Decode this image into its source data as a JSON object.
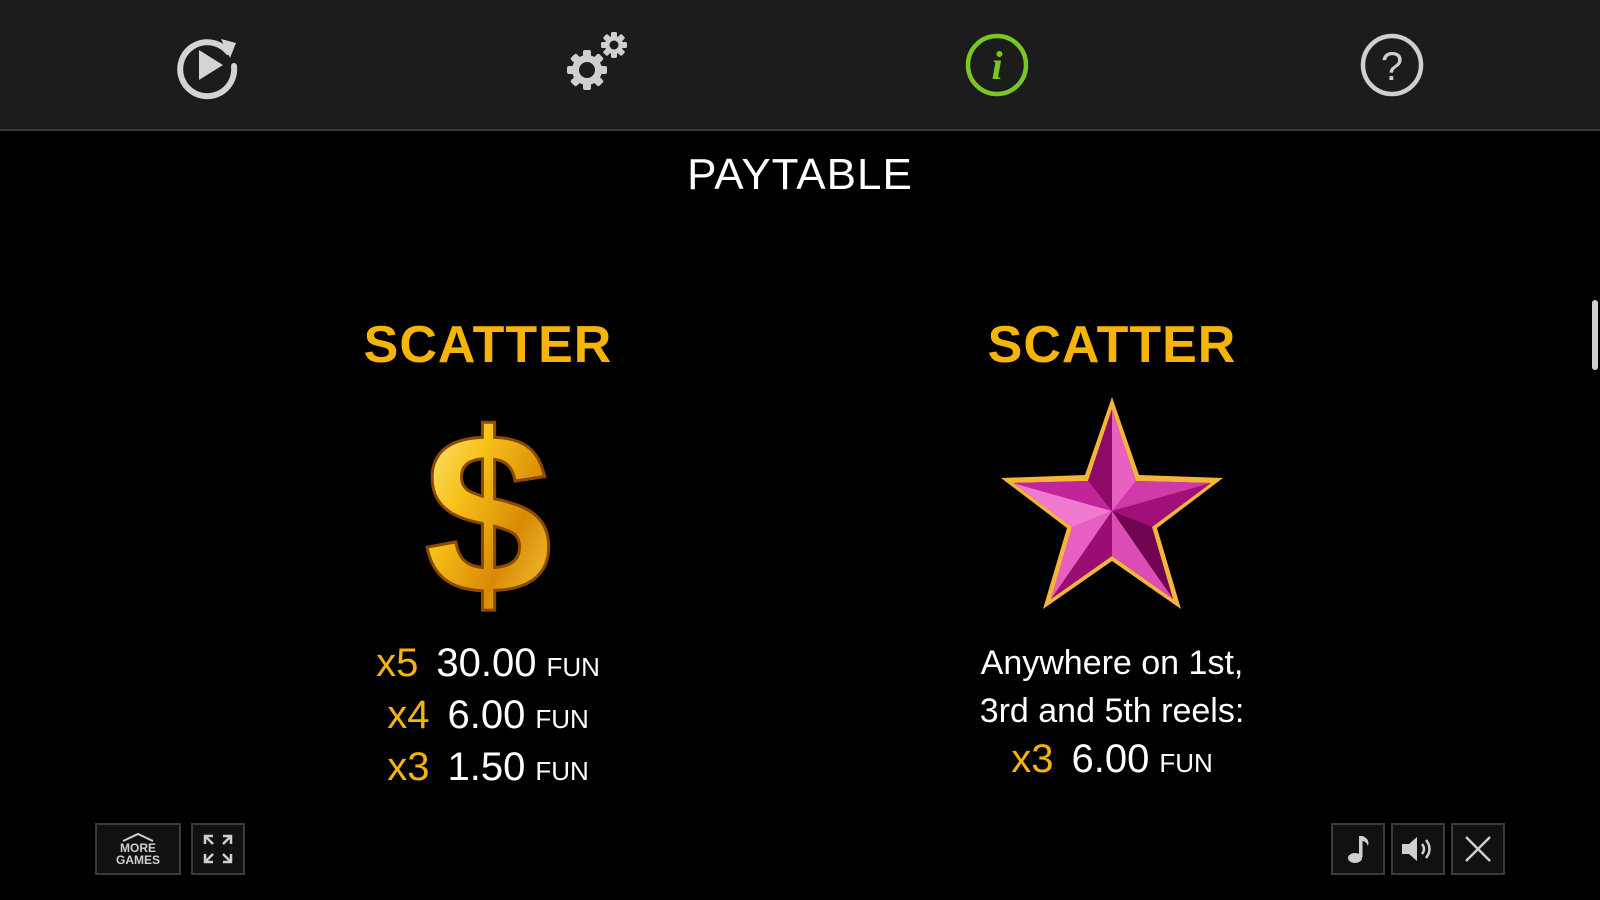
{
  "page": {
    "title": "PAYTABLE"
  },
  "toolbar": {
    "items": [
      {
        "icon": "replay-icon"
      },
      {
        "icon": "settings-gears-icon"
      },
      {
        "icon": "info-icon",
        "active": true
      },
      {
        "icon": "help-icon"
      }
    ]
  },
  "symbols": [
    {
      "title": "SCATTER",
      "icon": "dollar-sign-icon",
      "payouts": [
        {
          "multiplier": "x5",
          "amount": "30.00",
          "currency": "FUN"
        },
        {
          "multiplier": "x4",
          "amount": "6.00",
          "currency": "FUN"
        },
        {
          "multiplier": "x3",
          "amount": "1.50",
          "currency": "FUN"
        }
      ]
    },
    {
      "title": "SCATTER",
      "icon": "pink-star-icon",
      "description": [
        "Anywhere on 1st,",
        "3rd and 5th reels:"
      ],
      "payouts": [
        {
          "multiplier": "x3",
          "amount": "6.00",
          "currency": "FUN"
        }
      ]
    }
  ],
  "bottom_bar": {
    "more_games_label": [
      "MORE",
      "GAMES"
    ],
    "icons": [
      "home-icon",
      "fullscreen-icon",
      "music-note-icon",
      "speaker-icon",
      "close-icon"
    ]
  },
  "colors": {
    "accent_gold": "#f5b40a",
    "info_active_green": "#7cc623",
    "toolbar_bg": "#1c1c1c",
    "background": "#000000"
  }
}
